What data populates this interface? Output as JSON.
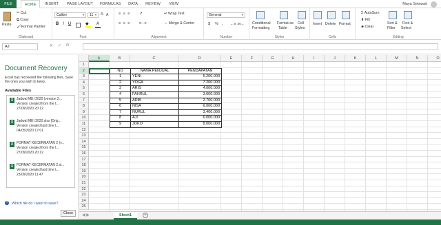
{
  "tabs": [
    "FILE",
    "HOME",
    "INSERT",
    "PAGE LAYOUT",
    "FORMULAS",
    "DATA",
    "REVIEW",
    "VIEW"
  ],
  "user": "Maya Selawati",
  "clipboard": {
    "paste": "Paste",
    "cut": "Cut",
    "copy": "Copy",
    "format_painter": "Format Painter",
    "title": "Clipboard"
  },
  "font": {
    "name": "Calibri",
    "size": "11",
    "title": "Font"
  },
  "alignment": {
    "wrap": "Wrap Text",
    "merge": "Merge & Center",
    "title": "Alignment"
  },
  "number": {
    "format": "General",
    "title": "Number",
    "currency": "$",
    "percent": "%",
    "comma": ","
  },
  "styles": {
    "cond": "Conditional",
    "cond2": "Formatting",
    "fmt_table": "Format as",
    "fmt_table2": "Table",
    "cell_styles": "Cell",
    "cell_styles2": "Styles",
    "title": "Styles"
  },
  "cells": {
    "insert": "Insert",
    "delete": "Delete",
    "format": "Format",
    "title": "Cells"
  },
  "editing": {
    "autosum": "AutoSum",
    "fill": "Fill",
    "clear": "Clear",
    "sort": "Sort &",
    "sort2": "Filter",
    "find": "Find &",
    "find2": "Select",
    "title": "Editing"
  },
  "namebox": "A2",
  "recovery": {
    "title": "Document Recovery",
    "desc": "Excel has recovered the following files. Save the ones you wish to keep.",
    "available": "Available Files",
    "files": [
      {
        "name": "Jadwal MEI 2020 (version 2...",
        "note": "Version created from the l...",
        "date": "27/09/2020 20:12"
      },
      {
        "name": "Jadwal MEI 2020.xlsx  [Orig...",
        "note": "Version created last time t...",
        "date": "04/05/2020 17:01"
      },
      {
        "name": "FORMAT KECERMATAN 2 (v...",
        "note": "Version created from the l...",
        "date": "27/09/2020 20:12"
      },
      {
        "name": "FORMAT KECERMATAN 2.xl...",
        "note": "Version created last time t...",
        "date": "23/09/2020 11:47"
      }
    ],
    "link": "Which file do I want to save?",
    "close": "Close"
  },
  "columns": [
    "A",
    "B",
    "C",
    "D",
    "E",
    "F",
    "G",
    "H",
    "I",
    "J",
    "K",
    "L",
    "M",
    "N",
    "O"
  ],
  "rows": [
    "1",
    "2",
    "3",
    "4",
    "5",
    "6",
    "7",
    "8",
    "9",
    "10",
    "11",
    "12",
    "13",
    "14",
    "15",
    "16",
    "17",
    "18",
    "19",
    "20",
    "21",
    "22",
    "23",
    "24",
    "25"
  ],
  "table": {
    "headers": [
      "NO",
      "NAMA PENJUAL",
      "PENDAPATAN"
    ],
    "rows": [
      [
        "1",
        "YENI",
        "5.200.000"
      ],
      [
        "2",
        "YOGA",
        "7.200.000"
      ],
      [
        "3",
        "ARIS",
        "4.000.000"
      ],
      [
        "4",
        "FAHRUL",
        "3.000.000"
      ],
      [
        "5",
        "ADIB",
        "2.700.000"
      ],
      [
        "6",
        "NISA",
        "6.000.000"
      ],
      [
        "7",
        "NURUL",
        "3.400.000"
      ],
      [
        "8",
        "AJI",
        "6.000.000"
      ],
      [
        "9",
        "JOKO",
        "8.000.000"
      ]
    ]
  },
  "sheet_tab": "Sheet1"
}
